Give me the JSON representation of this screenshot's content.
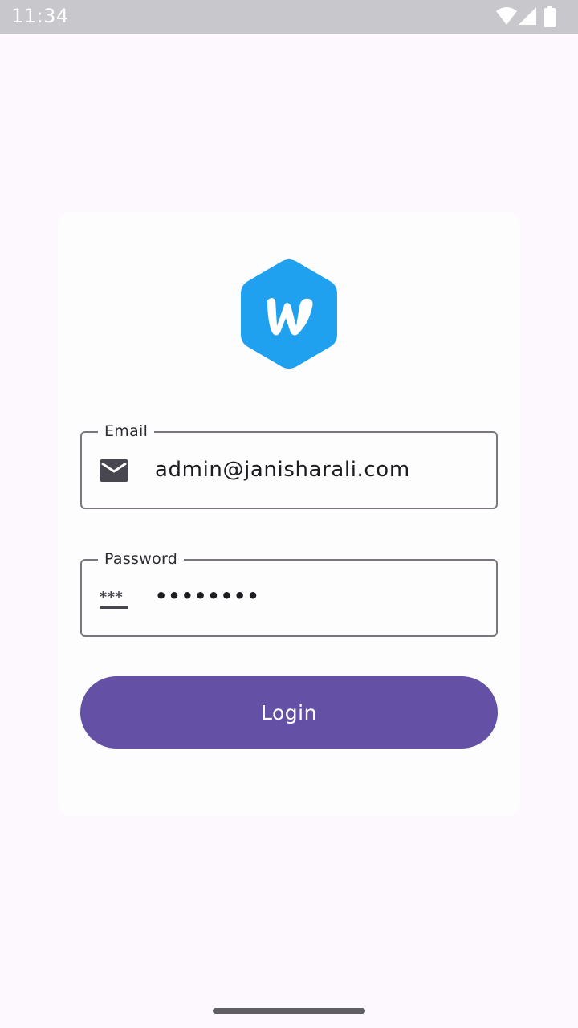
{
  "status_bar": {
    "time": "11:34",
    "icons": [
      "wifi-icon",
      "signal-icon",
      "battery-icon"
    ]
  },
  "logo": {
    "icon": "w-hexagon-logo-icon",
    "color": "#1fa1f0"
  },
  "email_field": {
    "label": "Email",
    "value": "admin@janisharali.com",
    "icon": "mail-icon"
  },
  "password_field": {
    "label": "Password",
    "value": "••••••••",
    "icon": "password-icon",
    "icon_text": "***"
  },
  "login_button": {
    "label": "Login",
    "color": "#6450a5"
  },
  "colors": {
    "background": "#fdf8fd",
    "card": "#fefdfe",
    "outline": "#79747e",
    "status_bar": "#c8c7cb"
  }
}
